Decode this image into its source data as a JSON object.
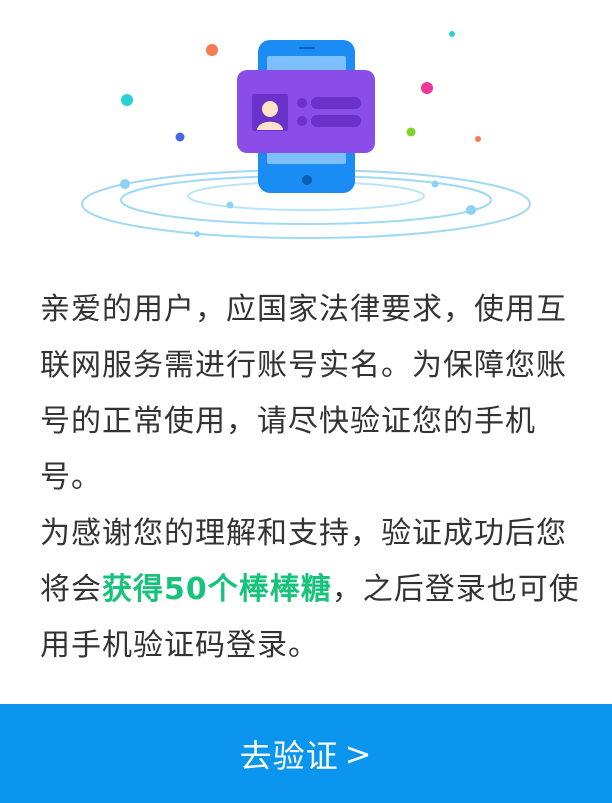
{
  "message": {
    "paragraph1": "亲爱的用户，应国家法律要求，使用互联网服务需进行账号实名。为保障您账号的正常使用，请尽快验证您的手机号。",
    "paragraph2_before": "为感谢您的理解和支持，验证成功后您将会",
    "paragraph2_highlight": "获得50个棒棒糖",
    "paragraph2_after": "，之后登录也可使用手机验证码登录。"
  },
  "cta": {
    "label": "去验证",
    "arrow": ">"
  },
  "colors": {
    "accent": "#0a95ee",
    "highlight": "#17c37b",
    "text": "#333333",
    "card": "#8a4de8",
    "phone": "#1e90ff"
  },
  "icons": {
    "illustration": "phone-id-verification-icon",
    "avatar": "person-avatar-icon"
  }
}
